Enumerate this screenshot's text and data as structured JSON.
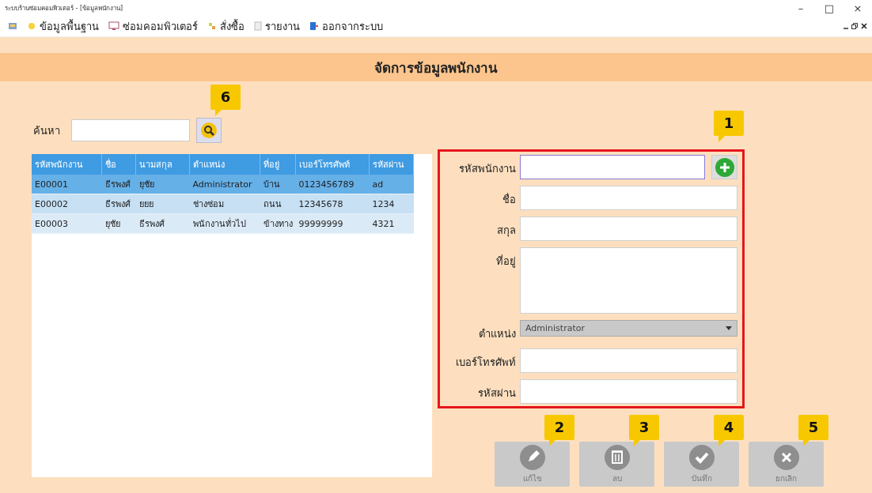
{
  "window": {
    "title": "ระบบร้านซ่อมคอมพิวเตอร์ - [ข้อมูลพนักงาน]",
    "controls": [
      "–",
      "□",
      "×"
    ]
  },
  "menu": [
    {
      "label": "ข้อมูลพื้นฐาน",
      "kind": "data"
    },
    {
      "label": "ซ่อมคอมพิวเตอร์",
      "kind": "repair"
    },
    {
      "label": "สั่งซื้อ",
      "kind": "order"
    },
    {
      "label": "รายงาน",
      "kind": "report"
    },
    {
      "label": "ออกจากระบบ",
      "kind": "logout"
    }
  ],
  "heading": "จัดการข้อมูลพนักงาน",
  "search": {
    "label": "ค้นหา",
    "callout": "6"
  },
  "table": {
    "columns": [
      "รหัสพนักงาน",
      "ชื่อ",
      "นามสกุล",
      "ตำแหน่ง",
      "ที่อยู่",
      "เบอร์โทรศัพท์",
      "รหัสผ่าน"
    ],
    "rows": [
      {
        "selected": true,
        "cells": [
          "E00001",
          "ธีรพงศ์",
          "ยุชัย",
          "Administrator",
          "บ้าน",
          "0123456789",
          "ad"
        ]
      },
      {
        "selected": false,
        "cells": [
          "E00002",
          "ธีรพงศ์",
          "ยยย",
          "ช่างซ่อม",
          "ถนน",
          "12345678",
          "1234"
        ]
      },
      {
        "selected": false,
        "cells": [
          "E00003",
          "ยุชัย",
          "ธีรพงศ์",
          "พนักงานทั่วไป",
          "ข้างทาง",
          "99999999",
          "4321"
        ]
      }
    ]
  },
  "form": {
    "callout": "1",
    "fields": [
      {
        "label": "รหัสพนักงาน",
        "kind": "text_add",
        "focused": true
      },
      {
        "label": "ชื่อ",
        "kind": "text",
        "focused": false
      },
      {
        "label": "สกุล",
        "kind": "text",
        "focused": false
      },
      {
        "label": "ที่อยู่",
        "kind": "textarea",
        "focused": false
      },
      {
        "label": "ตำแหน่ง",
        "kind": "select",
        "value": "Administrator",
        "focused": false
      },
      {
        "label": "เบอร์โทรศัพท์",
        "kind": "text",
        "focused": false
      },
      {
        "label": "รหัสผ่าน",
        "kind": "text",
        "focused": false
      }
    ]
  },
  "actions": [
    {
      "label": "แก้ไข",
      "kind": "edit",
      "disabled": true,
      "callout": "2"
    },
    {
      "label": "ลบ",
      "kind": "delete",
      "disabled": true,
      "callout": "3"
    },
    {
      "label": "บันทึก",
      "kind": "save",
      "disabled": true,
      "callout": "4"
    },
    {
      "label": "ยกเลิก",
      "kind": "cancel",
      "disabled": true,
      "callout": "5"
    }
  ]
}
